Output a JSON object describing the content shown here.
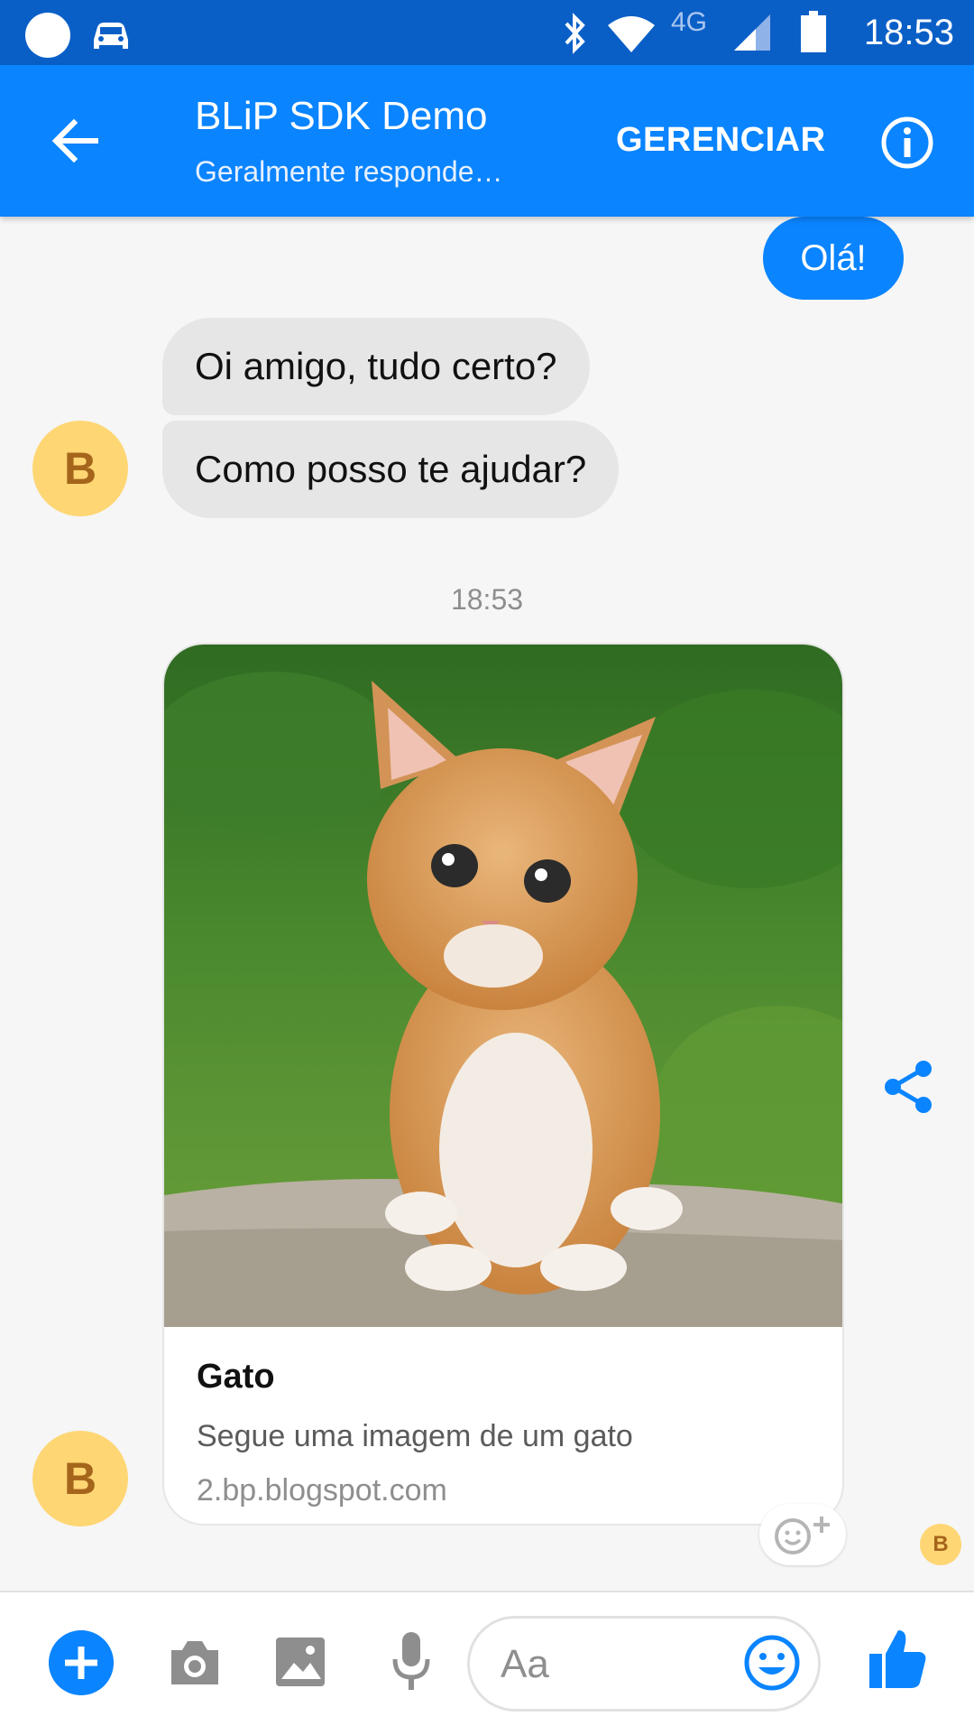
{
  "status_bar": {
    "time": "18:53",
    "network": "4G"
  },
  "header": {
    "title": "BLiP SDK Demo",
    "subtitle": "Geralmente responde…",
    "manage_label": "GERENCIAR"
  },
  "messages": {
    "outgoing": "Olá!",
    "incoming": [
      "Oi amigo, tudo certo?",
      "Como posso te ajudar?"
    ],
    "avatar_letter": "B",
    "timestamp": "18:53"
  },
  "card": {
    "title": "Gato",
    "description": "Segue uma imagem de um gato",
    "domain": "2.bp.blogspot.com"
  },
  "seen_avatar_letter": "B",
  "composer": {
    "placeholder": "Aa"
  },
  "colors": {
    "brand": "#0a84ff",
    "status_bar": "#0a5fc7",
    "avatar_bg": "#fed674"
  }
}
